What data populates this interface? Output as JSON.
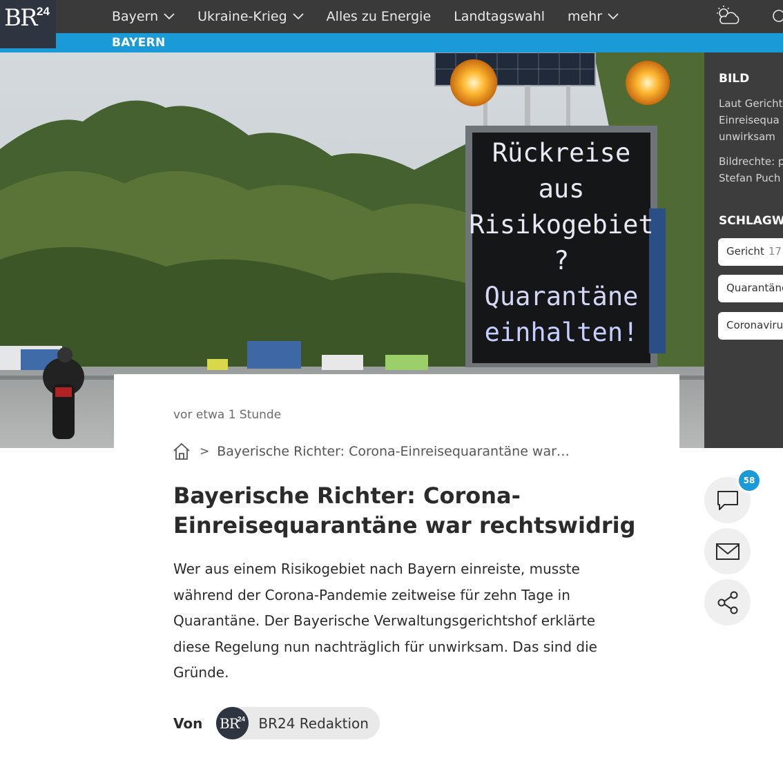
{
  "header": {
    "logo_text": "BR24",
    "nav": [
      {
        "label": "Bayern",
        "has_dropdown": true
      },
      {
        "label": "Ukraine-Krieg",
        "has_dropdown": true
      },
      {
        "label": "Alles zu Energie",
        "has_dropdown": false
      },
      {
        "label": "Landtagswahl",
        "has_dropdown": false
      },
      {
        "label": "mehr",
        "has_dropdown": true
      }
    ],
    "weather_icon": "partly-cloudy-icon",
    "section_label": "BAYERN",
    "accent_color": "#1a9ad6"
  },
  "hero": {
    "sign_lines": [
      "Rückreise",
      "aus",
      "Risikogebiet",
      "?",
      "Quarantäne",
      "einhalten!"
    ]
  },
  "side_panel": {
    "bild_heading": "BILD",
    "caption_lines": [
      "Laut Gericht",
      "Einreisequa",
      "unwirksam"
    ],
    "credit_lines": [
      "Bildrechte: p",
      "Stefan Puch"
    ],
    "tags_heading": "SCHLAGWO",
    "tags": [
      {
        "label": "Gericht",
        "count": "17"
      },
      {
        "label": "Quarantäne",
        "count": ""
      },
      {
        "label": "Coronaviru",
        "count": ""
      }
    ]
  },
  "article": {
    "time_ago": "vor etwa 1 Stunde",
    "breadcrumb_sep": ">",
    "breadcrumb_title": "Bayerische Richter: Corona-Einreisequarantäne war…",
    "headline": "Bayerische Richter: Corona-Einreisequarantäne war rechtswidrig",
    "teaser": "Wer aus einem Risikogebiet nach Bayern einreiste, musste während der Corona-Pandemie zeitweise für zehn Tage in Quarantäne. Der Bayerische Verwaltungsgerichtshof erklärte diese Regelung nun nachträglich für unwirksam. Das sind die Gründe.",
    "byline_prefix": "Von",
    "author_avatar_text": "BR24",
    "author": "BR24 Redaktion"
  },
  "actions": {
    "comment_count": "58",
    "comment_icon": "comment-icon",
    "mail_icon": "mail-icon",
    "share_icon": "share-icon"
  }
}
